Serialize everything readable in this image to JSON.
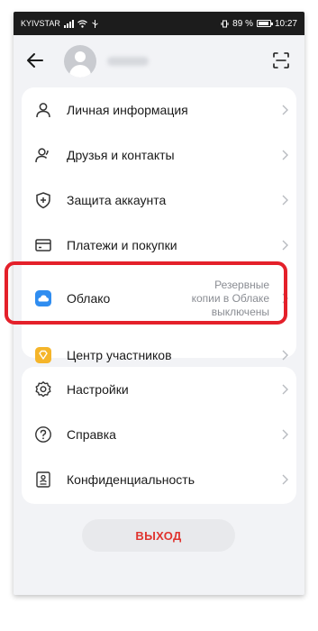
{
  "status_bar": {
    "carrier": "KYIVSTAR",
    "battery": "89 %",
    "time": "10:27"
  },
  "menu": {
    "items": [
      {
        "label": "Личная информация",
        "icon": "person-icon"
      },
      {
        "label": "Друзья и контакты",
        "icon": "people-icon"
      },
      {
        "label": "Защита аккаунта",
        "icon": "shield-plus-icon"
      },
      {
        "label": "Платежи и покупки",
        "icon": "card-icon"
      },
      {
        "label": "Облако",
        "icon": "cloud-icon",
        "hint_lines": [
          "Резервные",
          "копии в Облаке",
          "выключены"
        ]
      },
      {
        "label": "Центр участников",
        "icon": "member-diamond-icon"
      }
    ],
    "secondary_items": [
      {
        "label": "Настройки",
        "icon": "gear-icon"
      },
      {
        "label": "Справка",
        "icon": "question-icon"
      },
      {
        "label": "Конфиденциальность",
        "icon": "privacy-icon"
      }
    ]
  },
  "logout_label": "ВЫХОД",
  "colors": {
    "accent_red": "#e4202a",
    "logout_text": "#e0342f",
    "cloud_blue": "#2f8df0",
    "member_gold": "#f5b52a"
  }
}
